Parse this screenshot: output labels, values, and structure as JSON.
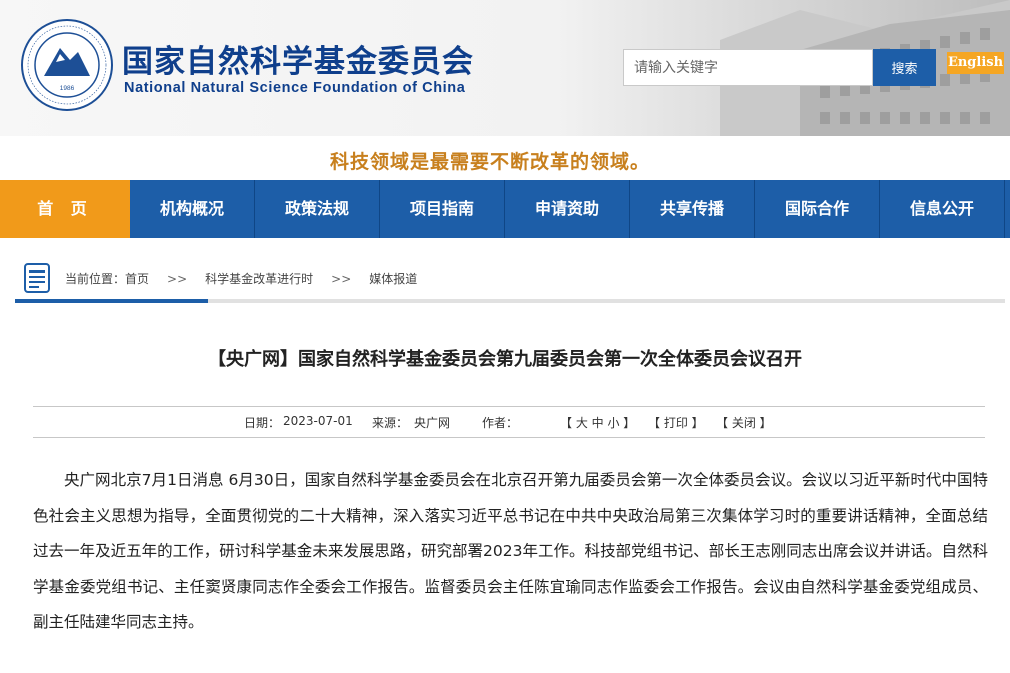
{
  "header": {
    "logo_year": "1986",
    "logo_ring_text": "国家自然科学基金委员会 · NATIONAL NATURAL SCIENCE FOUNDATION OF CHINA",
    "title_cn": "国家自然科学基金委员会",
    "title_en": "National Natural Science Foundation of China",
    "search_placeholder": "请输入关键字",
    "search_button": "搜索",
    "english_button": "English"
  },
  "slogan": "科技领域是最需要不断改革的领域。",
  "nav": {
    "items": [
      {
        "label": "首 页",
        "active": true
      },
      {
        "label": "机构概况"
      },
      {
        "label": "政策法规"
      },
      {
        "label": "项目指南"
      },
      {
        "label": "申请资助"
      },
      {
        "label": "共享传播"
      },
      {
        "label": "国际合作"
      },
      {
        "label": "信息公开"
      }
    ]
  },
  "breadcrumb": {
    "prefix": "当前位置：",
    "items": [
      "首页",
      "科学基金改革进行时",
      "媒体报道"
    ],
    "separator": ">>"
  },
  "article": {
    "title": "【央广网】国家自然科学基金委员会第九届委员会第一次全体委员会议召开",
    "date_label": "日期：",
    "date": "2023-07-01",
    "source_label": "来源：",
    "source": "央广网",
    "author_label": "作者：",
    "font_size_control": "【 大 中 小 】",
    "print": "【 打印 】",
    "close": "【 关闭 】",
    "body": "央广网北京7月1日消息 6月30日，国家自然科学基金委员会在北京召开第九届委员会第一次全体委员会议。会议以习近平新时代中国特色社会主义思想为指导，全面贯彻党的二十大精神，深入落实习近平总书记在中共中央政治局第三次集体学习时的重要讲话精神，全面总结过去一年及近五年的工作，研讨科学基金未来发展思路，研究部署2023年工作。科技部党组书记、部长王志刚同志出席会议并讲话。自然科学基金委党组书记、主任窦贤康同志作全委会工作报告。监督委员会主任陈宜瑜同志作监委会工作报告。会议由自然科学基金委党组成员、副主任陆建华同志主持。"
  },
  "colors": {
    "brand_blue": "#1d5ea8",
    "title_blue": "#0f3f8c",
    "accent_orange": "#f19a1a",
    "slogan_gold": "#c8801e"
  }
}
